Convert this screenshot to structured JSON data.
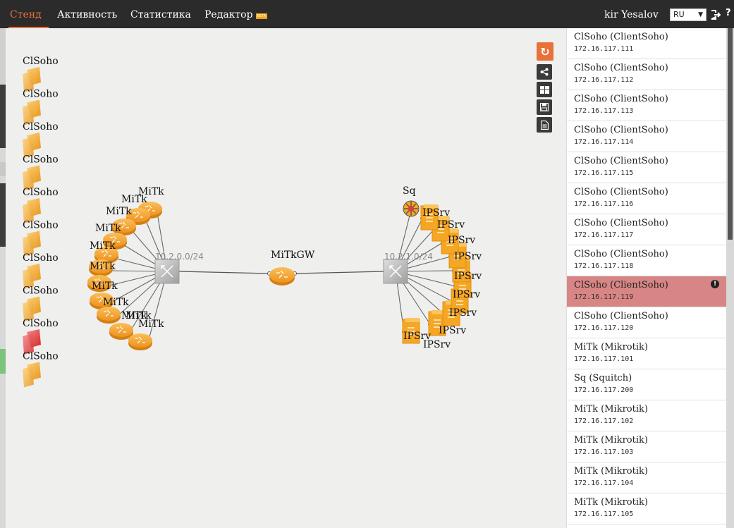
{
  "nav": {
    "tabs": [
      {
        "label": "Стенд",
        "active": true
      },
      {
        "label": "Активность"
      },
      {
        "label": "Статистика"
      },
      {
        "label": "Редактор",
        "badge": "BETA"
      }
    ],
    "user": "kir Yesalov",
    "language": "RU",
    "help": "?"
  },
  "colors": {
    "accent": "#e8703a",
    "device": "#f5a623",
    "switch": "#b8b8b8",
    "alert": "#d88585",
    "client_alert": "#e03a3a"
  },
  "toolbar": [
    {
      "name": "refresh",
      "icon": "refresh-icon"
    },
    {
      "name": "share",
      "icon": "share-icon"
    },
    {
      "name": "layout",
      "icon": "grid-icon"
    },
    {
      "name": "save",
      "icon": "save-icon"
    },
    {
      "name": "report",
      "icon": "document-icon"
    }
  ],
  "topology": {
    "clients": [
      "ClSoho",
      "ClSoho",
      "ClSoho",
      "ClSoho",
      "ClSoho",
      "ClSoho",
      "ClSoho",
      "ClSoho",
      "ClSoho",
      "ClSoho"
    ],
    "client_status": [
      "ok",
      "ok",
      "ok",
      "ok",
      "ok",
      "ok",
      "ok",
      "ok",
      "alert",
      "ok"
    ],
    "left_subnet": "10.2.0.0/24",
    "right_subnet": "10.2.1.0/24",
    "gateway": "MiTkGW",
    "left_routers": [
      "MiTk",
      "MiTk",
      "MiTk",
      "MiTk",
      "MiTk",
      "MiTk",
      "MiTk",
      "MiTk",
      "MiTk",
      "MiTk",
      "MiTk"
    ],
    "right_squid": "Sq",
    "right_servers": [
      "IPSrv",
      "IPSrv",
      "IPSrv",
      "IPSrv",
      "IPSrv",
      "IPSrv",
      "IPSrv",
      "IPSrv",
      "IPSrv",
      "IPSrv"
    ]
  },
  "hosts": [
    {
      "name": "ClSoho (ClientSoho)",
      "ip": "172.16.117.111",
      "status": "ok"
    },
    {
      "name": "ClSoho (ClientSoho)",
      "ip": "172.16.117.112",
      "status": "ok"
    },
    {
      "name": "ClSoho (ClientSoho)",
      "ip": "172.16.117.113",
      "status": "ok"
    },
    {
      "name": "ClSoho (ClientSoho)",
      "ip": "172.16.117.114",
      "status": "ok"
    },
    {
      "name": "ClSoho (ClientSoho)",
      "ip": "172.16.117.115",
      "status": "ok"
    },
    {
      "name": "ClSoho (ClientSoho)",
      "ip": "172.16.117.116",
      "status": "ok"
    },
    {
      "name": "ClSoho (ClientSoho)",
      "ip": "172.16.117.117",
      "status": "ok"
    },
    {
      "name": "ClSoho (ClientSoho)",
      "ip": "172.16.117.118",
      "status": "ok"
    },
    {
      "name": "ClSoho (ClientSoho)",
      "ip": "172.16.117.119",
      "status": "alert"
    },
    {
      "name": "ClSoho (ClientSoho)",
      "ip": "172.16.117.120",
      "status": "ok"
    },
    {
      "name": "MiTk (Mikrotik)",
      "ip": "172.16.117.101",
      "status": "ok"
    },
    {
      "name": "Sq (Squitch)",
      "ip": "172.16.117.200",
      "status": "ok"
    },
    {
      "name": "MiTk (Mikrotik)",
      "ip": "172.16.117.102",
      "status": "ok"
    },
    {
      "name": "MiTk (Mikrotik)",
      "ip": "172.16.117.103",
      "status": "ok"
    },
    {
      "name": "MiTk (Mikrotik)",
      "ip": "172.16.117.104",
      "status": "ok"
    },
    {
      "name": "MiTk (Mikrotik)",
      "ip": "172.16.117.105",
      "status": "ok"
    }
  ]
}
